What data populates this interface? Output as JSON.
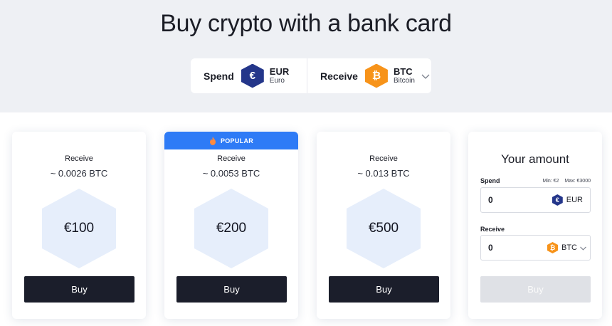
{
  "header": {
    "title": "Buy crypto with a bank card"
  },
  "picker": {
    "spend_label": "Spend",
    "spend_symbol": "€",
    "spend_code": "EUR",
    "spend_name": "Euro",
    "receive_label": "Receive",
    "receive_symbol": "₿",
    "receive_code": "BTC",
    "receive_name": "Bitcoin"
  },
  "offers": [
    {
      "receive_label": "Receive",
      "btc_amount": "~ 0.0026 BTC",
      "price": "€100",
      "buy_label": "Buy"
    },
    {
      "badge": "POPULAR",
      "receive_label": "Receive",
      "btc_amount": "~ 0.0053 BTC",
      "price": "€200",
      "buy_label": "Buy"
    },
    {
      "receive_label": "Receive",
      "btc_amount": "~ 0.013 BTC",
      "price": "€500",
      "buy_label": "Buy"
    }
  ],
  "your_amount": {
    "title": "Your amount",
    "spend_label": "Spend",
    "min": "Min: €2",
    "max": "Max: €3000",
    "spend_value": "0",
    "spend_symbol": "€",
    "spend_code": "EUR",
    "receive_label": "Receive",
    "receive_value": "0",
    "receive_symbol": "₿",
    "receive_code": "BTC",
    "buy_label": "Buy"
  },
  "colors": {
    "eur_icon": "#24368a",
    "btc_icon": "#f7931a",
    "popular_badge": "#2e7bf6",
    "buy_button": "#1b1e2b",
    "buy_disabled": "#dfe1e6"
  }
}
